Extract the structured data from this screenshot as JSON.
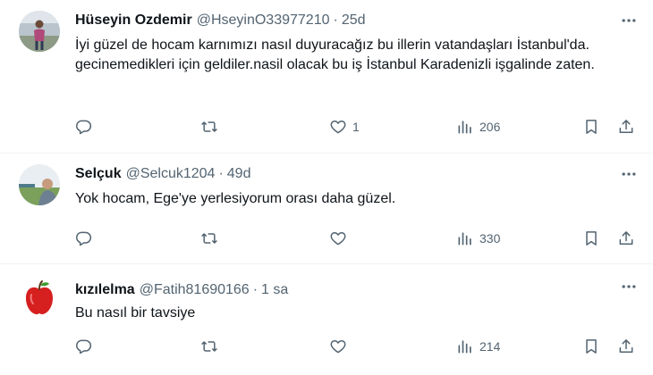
{
  "tweets": [
    {
      "name": "Hüseyin Ozdemir",
      "handle": "@HseyinO33977210",
      "dot": "·",
      "time": "25d",
      "text": "İyi güzel de hocam karnımızı nasıl duyuracağız bu illerin vatandaşları İstanbul'da. gecinemedikleri için geldiler.nasil olacak bu iş İstanbul Karadenizli işgalinde zaten.",
      "likes": "1",
      "views": "206",
      "avatar_icon": "person-photo-avatar"
    },
    {
      "name": "Selçuk",
      "handle": "@Selcuk1204",
      "dot": "·",
      "time": "49d",
      "text": "Yok hocam, Ege'ye yerlesiyorum orası daha güzel.",
      "likes": "",
      "views": "330",
      "avatar_icon": "person-photo-avatar"
    },
    {
      "name": "kızılelma",
      "handle": "@Fatih81690166",
      "dot": "·",
      "time": "1 sa",
      "text": "Bu nasıl bir tavsiye",
      "likes": "",
      "views": "214",
      "avatar_icon": "red-apple-avatar"
    }
  ],
  "colors": {
    "text": "#0f1419",
    "secondary": "#536471",
    "divider": "#eff3f4"
  }
}
